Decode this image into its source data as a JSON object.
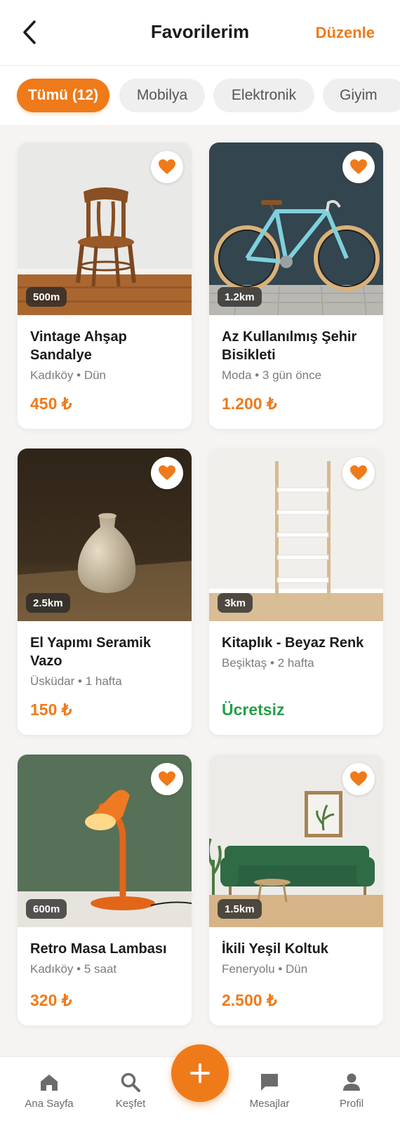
{
  "header": {
    "title": "Favorilerim",
    "edit_label": "Düzenle"
  },
  "filters": [
    {
      "label": "Tümü (12)",
      "active": true
    },
    {
      "label": "Mobilya",
      "active": false
    },
    {
      "label": "Elektronik",
      "active": false
    },
    {
      "label": "Giyim",
      "active": false
    }
  ],
  "items": [
    {
      "title_line1": "Vintage Ahşap",
      "title_line2": "Sandalye",
      "meta": "Kadıköy • Dün",
      "price": "450 ₺",
      "distance": "500m",
      "image": "wooden-chair"
    },
    {
      "title_line1": "Az Kullanılmış Şehir",
      "title_line2": "Bisikleti",
      "meta": "Moda • 3 gün önce",
      "price": "1.200 ₺",
      "distance": "1.2km",
      "image": "city-bike"
    },
    {
      "title_line1": "El Yapımı Seramik",
      "title_line2": "Vazo",
      "meta": "Üsküdar • 1 hafta",
      "price": "150 ₺",
      "distance": "2.5km",
      "image": "ceramic-vase"
    },
    {
      "title_line1": "Kitaplık - Beyaz Renk",
      "title_line2": "",
      "meta": "Beşiktaş • 2 hafta",
      "price": "Ücretsiz",
      "distance": "3km",
      "image": "white-bookshelf"
    },
    {
      "title_line1": "Retro Masa Lambası",
      "title_line2": "",
      "meta": "Kadıköy • 5 saat",
      "price": "320 ₺",
      "distance": "600m",
      "image": "orange-desk-lamp"
    },
    {
      "title_line1": "İkili Yeşil Koltuk",
      "title_line2": "",
      "meta": "Feneryolu • Dün",
      "price": "2.500 ₺",
      "distance": "1.5km",
      "image": "green-sofa"
    }
  ],
  "nav": {
    "home": "Ana Sayfa",
    "explore": "Keşfet",
    "messages": "Mesajlar",
    "profile": "Profil"
  },
  "colors": {
    "accent": "#ef7a1a",
    "free": "#23a047",
    "background": "#f6f4f3"
  }
}
